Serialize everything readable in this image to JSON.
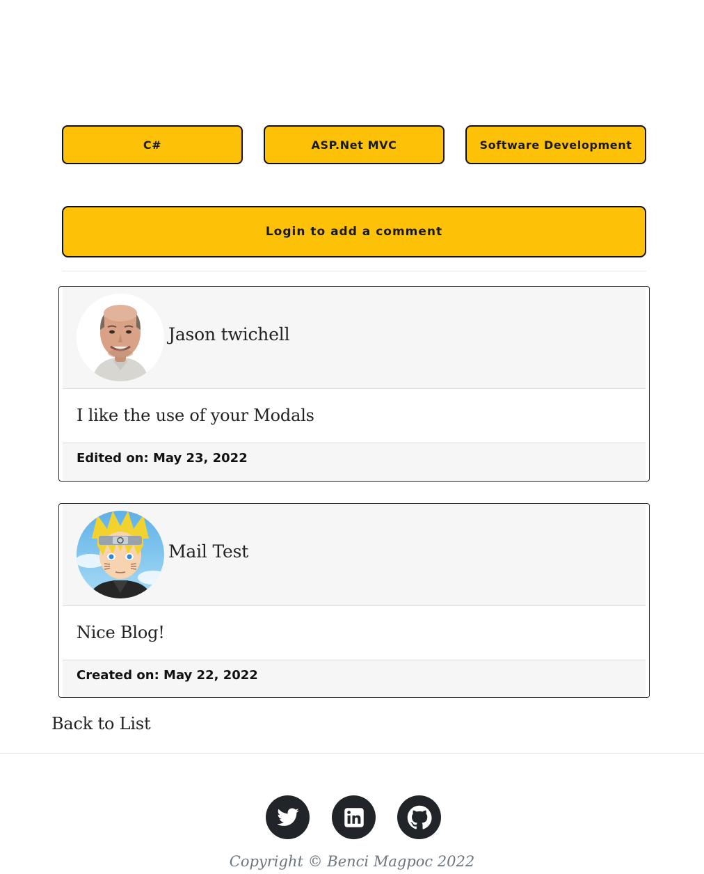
{
  "tags": [
    "C#",
    "ASP.Net MVC",
    "Software Development"
  ],
  "comment_form": {
    "login_label": "Login to add a comment"
  },
  "comments": [
    {
      "author": "Jason twichell",
      "avatar": "bald-man-photo",
      "text": "I like the use of your Modals",
      "date_label": "Edited on: May 23, 2022"
    },
    {
      "author": "Mail Test",
      "avatar": "anime-ninja-photo",
      "text": "Nice Blog!",
      "date_label": "Created on: May 22, 2022"
    }
  ],
  "nav": {
    "back_label": "Back to List"
  },
  "footer": {
    "social": [
      "twitter-icon",
      "linkedin-icon",
      "github-icon"
    ],
    "copyright": "Copyright © Benci Magpoc 2022"
  },
  "colors": {
    "accent": "#fdc107",
    "dark": "#212529",
    "muted": "#6c757d"
  }
}
